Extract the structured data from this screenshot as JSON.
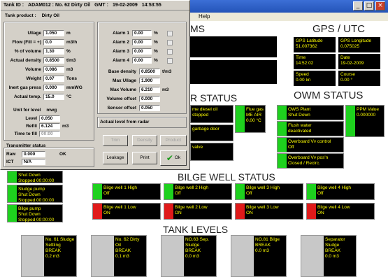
{
  "window": {
    "menu": "Help",
    "min": "_",
    "max": "□",
    "close": "×"
  },
  "sections": {
    "alarms": "MS",
    "gps": "GPS / UTC",
    "motor_status": "R STATUS",
    "owm_status": "OWM STATUS",
    "bilge_status": "BILGE WELL STATUS",
    "tank_levels": "TANK LEVELS"
  },
  "gps": {
    "lat_label": "GPS Latitude",
    "lat_value": "51.007362",
    "lon_label": "GPS Longitude",
    "lon_value": "0.075025",
    "time_label": "Time",
    "time_value": "14:52:02",
    "date_label": "Date",
    "date_value": "19-02-2009",
    "speed_label": "Speed",
    "speed_value": "0.00  kn",
    "course_label": "Course",
    "course_value": "0.00  °"
  },
  "motor": {
    "c1_a": "me diesel oil",
    "c1_b": "stopped",
    "c2": "garbage door",
    "c3": "valve",
    "flow_label": "Flue gas",
    "flow_b": "ME AIR",
    "flow_value": "0.00    °C"
  },
  "owm": {
    "c1_a": "OWS Plant",
    "c1_b": "Shut Down",
    "c2_a": "Flush water",
    "c2_b": "deactivated",
    "c3_a": "Overboard Vv control",
    "c3_b": "Off",
    "c4_a": "Overboard Vv pos'n",
    "c4_b": "Closed / Recirc.",
    "ppm_label": "PPM Value",
    "ppm_value": "0.000000"
  },
  "left_status": [
    {
      "a": "Shut Down",
      "b": "Stopped 00:00:00"
    },
    {
      "a": "Sludge pump",
      "b": "Shut Down",
      "c": "Stopped 00:00:00"
    },
    {
      "a": "Bilge pump",
      "b": "Shut Down",
      "c": "Stopped 00:00:00"
    }
  ],
  "bilge": [
    {
      "high_a": "Bilge well 1 High",
      "high_b": "Off",
      "low_a": "Bilge well 1 Low",
      "low_b": "ON"
    },
    {
      "high_a": "Bilge well 2 High",
      "high_b": "Off",
      "low_a": "Bilge well 2 Low",
      "low_b": "ON"
    },
    {
      "high_a": "Bilge well 3 High",
      "high_b": "Off",
      "low_a": "Bilge well 3 Low",
      "low_b": "ON"
    },
    {
      "high_a": "Bilge well 4 High",
      "high_b": "Off",
      "low_a": "Bilge well 4 Low",
      "low_b": "ON"
    }
  ],
  "tanks": [
    {
      "name": "No. 61 Sludge Settling",
      "state": "BREAK",
      "value": "0.2  m3"
    },
    {
      "name": "No. 62 Dirty Oil",
      "state": "BREAK",
      "value": "0.1  m3"
    },
    {
      "name": "NO.63 Sep. Sludge",
      "state": "BREAK",
      "value": "0.0  m3"
    },
    {
      "name": "NO.81 Bilge",
      "state": "BREAK",
      "value": "0.0  m3"
    },
    {
      "name": "Separator Sludge",
      "state": "BREAK",
      "value": "0.0  m3"
    }
  ],
  "dialog": {
    "tank_id_label": "Tank ID :",
    "tank_id": "ADAM012 : No. 62 Dirty Oil",
    "gmt_label": "GMT :",
    "date": "19-02-2009",
    "time": "14:53:55",
    "tank_product_label": "Tank product :",
    "tank_product": "Dirty Oil",
    "fields": [
      {
        "label": "Ullage",
        "value": "1.050",
        "unit": "m"
      },
      {
        "label": "Flow (Fill = +)",
        "value": "0.0",
        "unit": "m3/h"
      },
      {
        "label": "% of volume",
        "value": "1.30",
        "unit": "%"
      },
      {
        "label": "Actual density",
        "value": "0.8500",
        "unit": "t/m3"
      },
      {
        "label": "Volume",
        "value": "0.086",
        "unit": "m3"
      },
      {
        "label": "Weight",
        "value": "0.07",
        "unit": "Tons"
      },
      {
        "label": "Inert gas press",
        "value": "0.000",
        "unit": "mmWG"
      },
      {
        "label": "Actual temp.",
        "value": "15.0",
        "unit": "°C"
      }
    ],
    "unit_level_label": "Unit for level",
    "unit_level_value": "mwg",
    "level_label": "Level",
    "level_value": "0.050",
    "refill_label": "Refill",
    "refill_value": "6.124",
    "refill_unit": "m3",
    "time_to_fill_label": "Time to fill",
    "time_to_fill_value": "00:00",
    "alarms": [
      {
        "label": "Alarm 1",
        "value": "0.00",
        "unit": "%"
      },
      {
        "label": "Alarm 2",
        "value": "0.00",
        "unit": "%"
      },
      {
        "label": "Alarm 3",
        "value": "0.00",
        "unit": "%"
      },
      {
        "label": "Alarm 4",
        "value": "0.00",
        "unit": "%"
      }
    ],
    "base_density_label": "Base density",
    "base_density_value": "0.8500",
    "base_density_unit": "t/m3",
    "max_ullage_label": "Max Ullage",
    "max_ullage_value": "1.900",
    "max_volume_label": "Max Volume",
    "max_volume_value": "6.210",
    "max_volume_unit": "m3",
    "volume_offset_label": "Volume offset",
    "volume_offset_value": "0.000",
    "sensor_offset_label": "Sensor offset",
    "sensor_offset_value": "0.050",
    "actual_level_label": "Actual level from radar",
    "transmitter_label": "Transmitter status",
    "raw_label": "Raw",
    "raw_value": "0.000",
    "raw_status": "OK",
    "ict_label": "ICT",
    "ict_value": "N/A",
    "btn_trim": "Trim",
    "btn_density": "Density",
    "btn_product": "Product",
    "btn_leakage": "Leakage",
    "btn_print": "Print",
    "btn_ok": "Ok"
  }
}
